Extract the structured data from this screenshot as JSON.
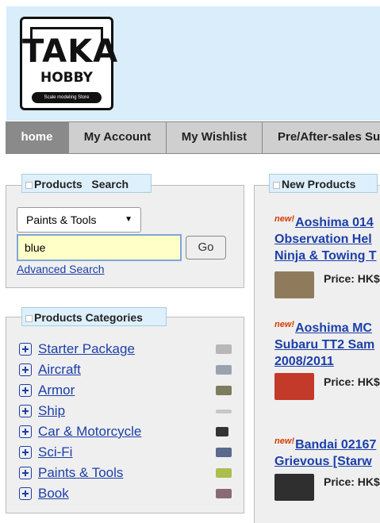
{
  "logo": {
    "title": "TAKA",
    "subtitle": "HOBBY",
    "tagline": "Scale modeling Store"
  },
  "nav": {
    "tabs": [
      "home",
      "My Account",
      "My Wishlist",
      "Pre/After-sales Su"
    ]
  },
  "search": {
    "title": "Products",
    "title2": "Search",
    "category_selected": "Paints & Tools",
    "value": "blue",
    "go_label": "Go",
    "advanced_label": "Advanced Search"
  },
  "categories": {
    "title": "Products Categories",
    "items": [
      "Starter Package",
      "Aircraft",
      "Armor",
      "Ship",
      "Car & Motorcycle",
      "Sci-Fi",
      "Paints & Tools",
      "Book"
    ]
  },
  "new_products": {
    "title": "New Products",
    "new_badge": "new!",
    "items": [
      {
        "name": "Aoshima 014 Observation Hel Ninja & Towing T",
        "price": "Price: HK$"
      },
      {
        "name": "Aoshima MC Subaru TT2 Sam 2008/2011",
        "price": "Price: HK$"
      },
      {
        "name": "Bandai 02167 Grievous [Starw",
        "price": "Price: HK$"
      }
    ]
  }
}
